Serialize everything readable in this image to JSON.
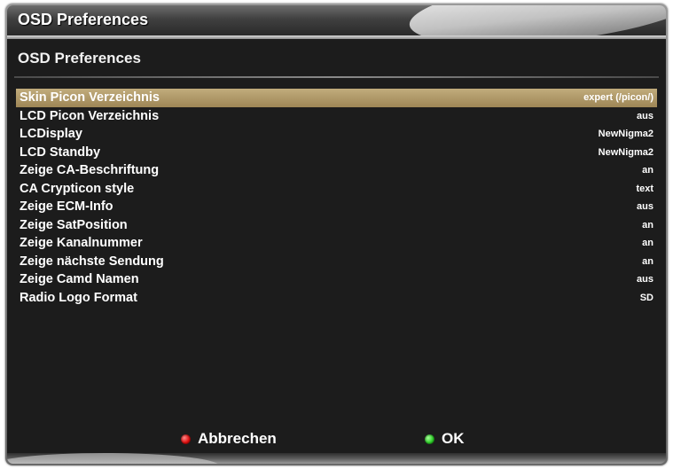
{
  "window": {
    "title": "OSD Preferences"
  },
  "screen": {
    "subtitle": "OSD Preferences"
  },
  "settings": [
    {
      "label": "Skin Picon Verzeichnis",
      "value": "expert (/picon/)",
      "selected": true
    },
    {
      "label": "LCD Picon Verzeichnis",
      "value": "aus",
      "selected": false
    },
    {
      "label": "LCDisplay",
      "value": "NewNigma2",
      "selected": false
    },
    {
      "label": "LCD Standby",
      "value": "NewNigma2",
      "selected": false
    },
    {
      "label": "Zeige CA-Beschriftung",
      "value": "an",
      "selected": false
    },
    {
      "label": "CA Crypticon style",
      "value": "text",
      "selected": false
    },
    {
      "label": "Zeige ECM-Info",
      "value": "aus",
      "selected": false
    },
    {
      "label": "Zeige SatPosition",
      "value": "an",
      "selected": false
    },
    {
      "label": "Zeige Kanalnummer",
      "value": "an",
      "selected": false
    },
    {
      "label": "Zeige nächste Sendung",
      "value": "an",
      "selected": false
    },
    {
      "label": "Zeige Camd Namen",
      "value": "aus",
      "selected": false
    },
    {
      "label": "Radio Logo Format",
      "value": "SD",
      "selected": false
    }
  ],
  "buttons": {
    "red": {
      "label": "Abbrechen",
      "color": "#e01010",
      "icon": "red-key-icon"
    },
    "green": {
      "label": "OK",
      "color": "#2fcf2a",
      "icon": "green-key-icon"
    }
  },
  "colors": {
    "selection": "#b39c6a",
    "background": "#1c1c1c"
  }
}
